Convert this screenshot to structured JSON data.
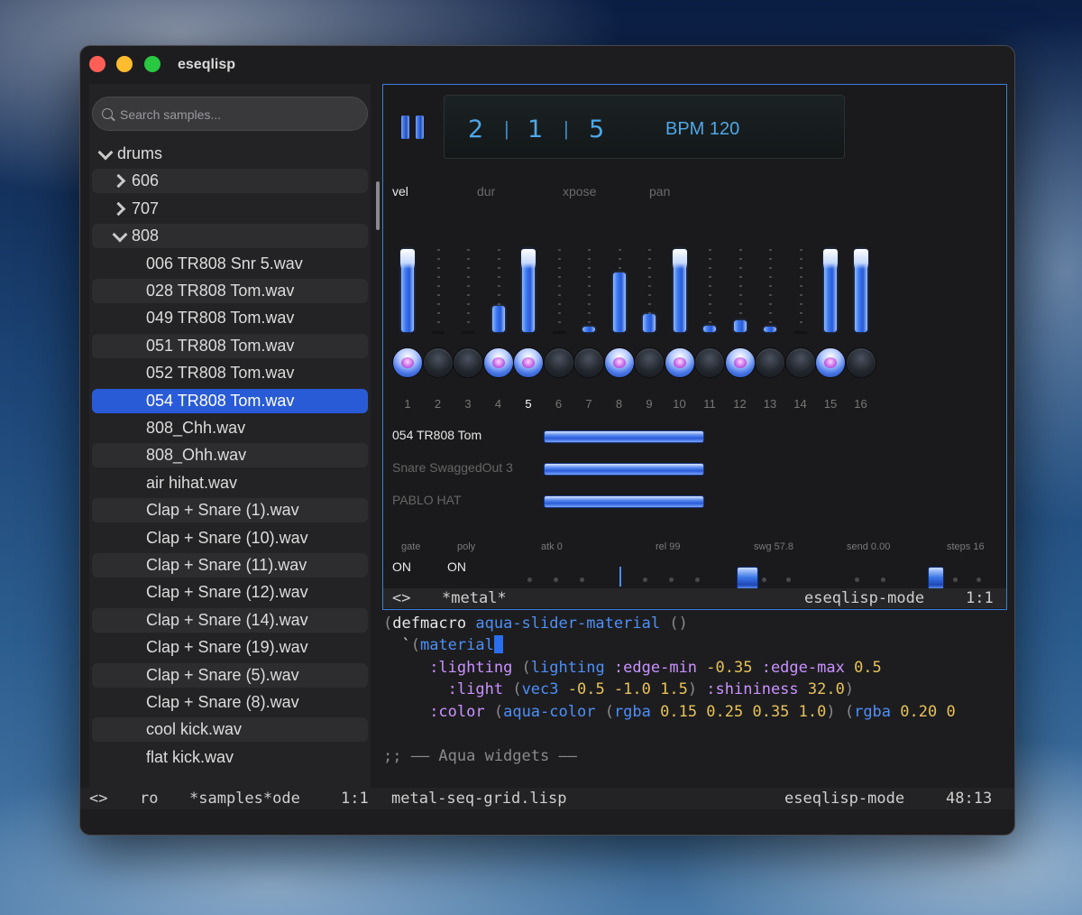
{
  "window": {
    "title": "eseqlisp"
  },
  "search": {
    "placeholder": "Search samples..."
  },
  "tree": [
    {
      "label": "drums",
      "level": 0,
      "chevron": "down"
    },
    {
      "label": "606",
      "level": 1,
      "chevron": "right"
    },
    {
      "label": "707",
      "level": 1,
      "chevron": "right"
    },
    {
      "label": "808",
      "level": 1,
      "chevron": "down"
    },
    {
      "label": "006 TR808 Snr 5.wav",
      "level": 2
    },
    {
      "label": "028 TR808 Tom.wav",
      "level": 2
    },
    {
      "label": "049 TR808 Tom.wav",
      "level": 2
    },
    {
      "label": "051 TR808 Tom.wav",
      "level": 2
    },
    {
      "label": "052 TR808 Tom.wav",
      "level": 2
    },
    {
      "label": "054 TR808 Tom.wav",
      "level": 2,
      "selected": true
    },
    {
      "label": "808_Chh.wav",
      "level": 2
    },
    {
      "label": "808_Ohh.wav",
      "level": 2
    },
    {
      "label": "air hihat.wav",
      "level": 2
    },
    {
      "label": "Clap + Snare (1).wav",
      "level": 2
    },
    {
      "label": "Clap + Snare (10).wav",
      "level": 2
    },
    {
      "label": "Clap + Snare (11).wav",
      "level": 2
    },
    {
      "label": "Clap + Snare (12).wav",
      "level": 2
    },
    {
      "label": "Clap + Snare (14).wav",
      "level": 2
    },
    {
      "label": "Clap + Snare (19).wav",
      "level": 2
    },
    {
      "label": "Clap + Snare (5).wav",
      "level": 2
    },
    {
      "label": "Clap + Snare (8).wav",
      "level": 2
    },
    {
      "label": "cool kick.wav",
      "level": 2
    },
    {
      "label": "flat kick.wav",
      "level": 2
    }
  ],
  "transport": {
    "bar": "2",
    "beat": "1",
    "tick": "5",
    "sep": "|",
    "bpm": "BPM 120"
  },
  "param_tabs": [
    {
      "label": "vel",
      "active": true
    },
    {
      "label": "dur"
    },
    {
      "label": "xpose"
    },
    {
      "label": "pan"
    }
  ],
  "steps": [
    {
      "num": "1",
      "on": true,
      "level": 1.0
    },
    {
      "num": "2",
      "on": false,
      "level": 0.0
    },
    {
      "num": "3",
      "on": false,
      "level": 0.0
    },
    {
      "num": "4",
      "on": true,
      "level": 0.32
    },
    {
      "num": "5",
      "on": true,
      "level": 1.0,
      "current": true
    },
    {
      "num": "6",
      "on": false,
      "level": 0.0
    },
    {
      "num": "7",
      "on": false,
      "level": 0.06
    },
    {
      "num": "8",
      "on": true,
      "level": 0.72
    },
    {
      "num": "9",
      "on": false,
      "level": 0.22
    },
    {
      "num": "10",
      "on": true,
      "level": 1.0
    },
    {
      "num": "11",
      "on": false,
      "level": 0.08
    },
    {
      "num": "12",
      "on": true,
      "level": 0.14
    },
    {
      "num": "13",
      "on": false,
      "level": 0.04
    },
    {
      "num": "14",
      "on": false,
      "level": 0.0
    },
    {
      "num": "15",
      "on": true,
      "level": 1.0
    },
    {
      "num": "16",
      "on": false,
      "level": 1.0
    }
  ],
  "tracks": [
    {
      "name": "054 TR808 Tom",
      "active": true
    },
    {
      "name": "Snare SwaggedOut 3"
    },
    {
      "name": "PABLO HAT"
    }
  ],
  "params": {
    "gate_label": "gate",
    "gate_value": "ON",
    "poly_label": "poly",
    "poly_value": "ON",
    "atk": "atk 0",
    "rel": "rel 99",
    "swg": "swg 57.8",
    "send": "send 0.00",
    "steps": "steps 16"
  },
  "seq_modeline": {
    "arrows": "<>",
    "buffer": "*metal*",
    "mode": "eseqlisp-mode",
    "pos": "1:1"
  },
  "code": [
    [
      [
        "par",
        "("
      ],
      [
        "kw",
        "defmacro "
      ],
      [
        "fn",
        "aqua-slider-material"
      ],
      [
        "kw",
        " "
      ],
      [
        "par",
        "()"
      ]
    ],
    [
      [
        "kw",
        "  `"
      ],
      [
        "par",
        "("
      ],
      [
        "fn",
        "material"
      ]
    ],
    [
      [
        "kw",
        "     "
      ],
      [
        "key",
        ":lighting "
      ],
      [
        "par",
        "("
      ],
      [
        "fn",
        "lighting "
      ],
      [
        "key",
        ":edge-min "
      ],
      [
        "num",
        "-0.35 "
      ],
      [
        "key",
        ":edge-max "
      ],
      [
        "num",
        "0.5"
      ]
    ],
    [
      [
        "kw",
        "       "
      ],
      [
        "key",
        ":light "
      ],
      [
        "par",
        "("
      ],
      [
        "fn",
        "vec3 "
      ],
      [
        "num",
        "-0.5 -1.0 1.5"
      ],
      [
        "par",
        ") "
      ],
      [
        "key",
        ":shininess "
      ],
      [
        "num",
        "32.0"
      ],
      [
        "par",
        ")"
      ]
    ],
    [
      [
        "kw",
        "     "
      ],
      [
        "key",
        ":color "
      ],
      [
        "par",
        "("
      ],
      [
        "fn",
        "aqua-color "
      ],
      [
        "par",
        "("
      ],
      [
        "fn",
        "rgba "
      ],
      [
        "num",
        "0.15 0.25 0.35 1.0"
      ],
      [
        "par",
        ") ("
      ],
      [
        "fn",
        "rgba "
      ],
      [
        "num",
        "0.20 0"
      ]
    ],
    [],
    [
      [
        "cmt",
        ";; —— Aqua widgets ——"
      ]
    ]
  ],
  "bottom_left": {
    "arrows": "<>",
    "ro": "ro",
    "buffer": "*samples*ode",
    "pos": "1:1"
  },
  "bottom_right": {
    "file": "metal-seq-grid.lisp",
    "mode": "eseqlisp-mode",
    "pos": "48:13"
  }
}
